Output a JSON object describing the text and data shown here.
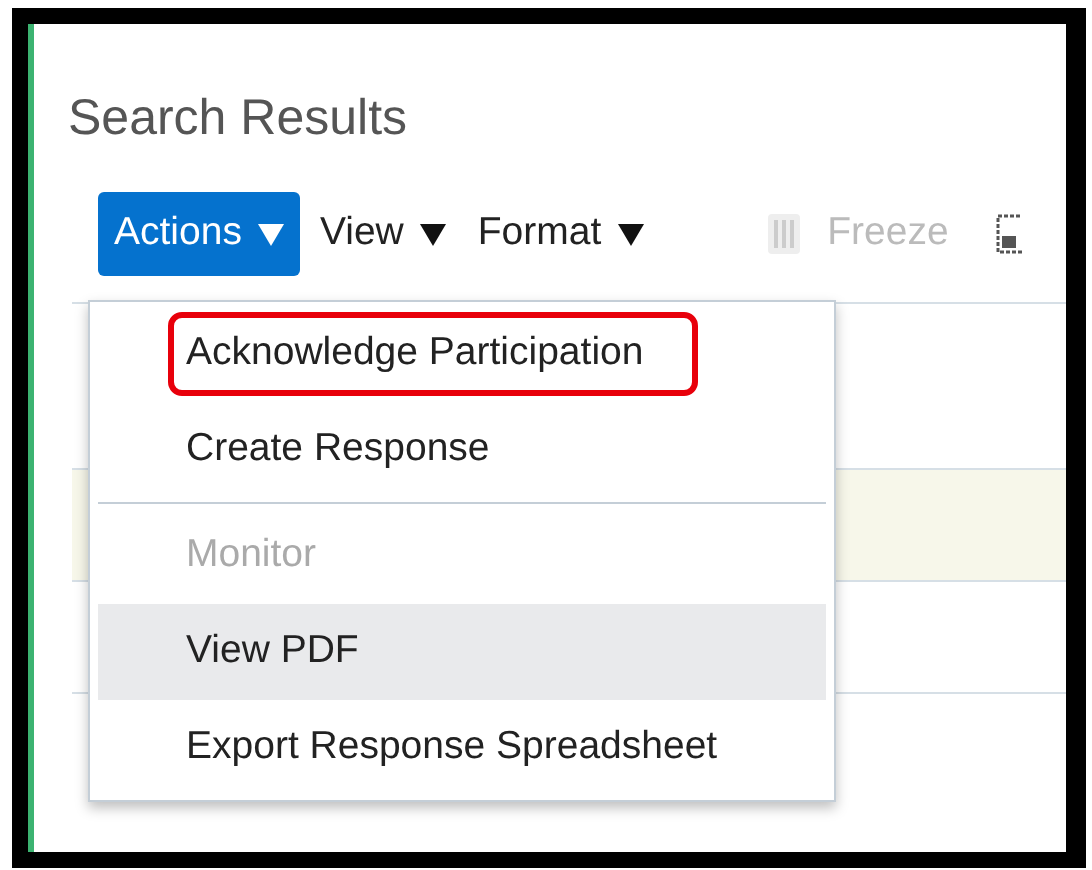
{
  "title": "Search Results",
  "toolbar": [
    {
      "kind": "menu",
      "label": "Actions",
      "selected": true,
      "disabled": false
    },
    {
      "kind": "menu",
      "label": "View",
      "selected": false,
      "disabled": false
    },
    {
      "kind": "menu",
      "label": "Format",
      "selected": false,
      "disabled": false
    },
    {
      "kind": "button",
      "label": "Freeze",
      "selected": false,
      "disabled": true
    },
    {
      "kind": "icon",
      "selected": false,
      "disabled": false
    }
  ],
  "table_rows": [
    {
      "selected": false
    },
    {
      "selected": true
    },
    {
      "selected": false
    },
    {
      "selected": false
    }
  ],
  "menu": {
    "items": [
      {
        "label": "Acknowledge Participation",
        "disabled": false,
        "hovered": false,
        "highlighted": true,
        "divider_after": false
      },
      {
        "label": "Create Response",
        "disabled": false,
        "hovered": false,
        "highlighted": false,
        "divider_after": true
      },
      {
        "label": "Monitor",
        "disabled": true,
        "hovered": false,
        "highlighted": false,
        "divider_after": false
      },
      {
        "label": "View PDF",
        "disabled": false,
        "hovered": true,
        "highlighted": false,
        "divider_after": false
      },
      {
        "label": "Export Response Spreadsheet",
        "disabled": false,
        "hovered": false,
        "highlighted": false,
        "divider_after": false
      }
    ]
  }
}
